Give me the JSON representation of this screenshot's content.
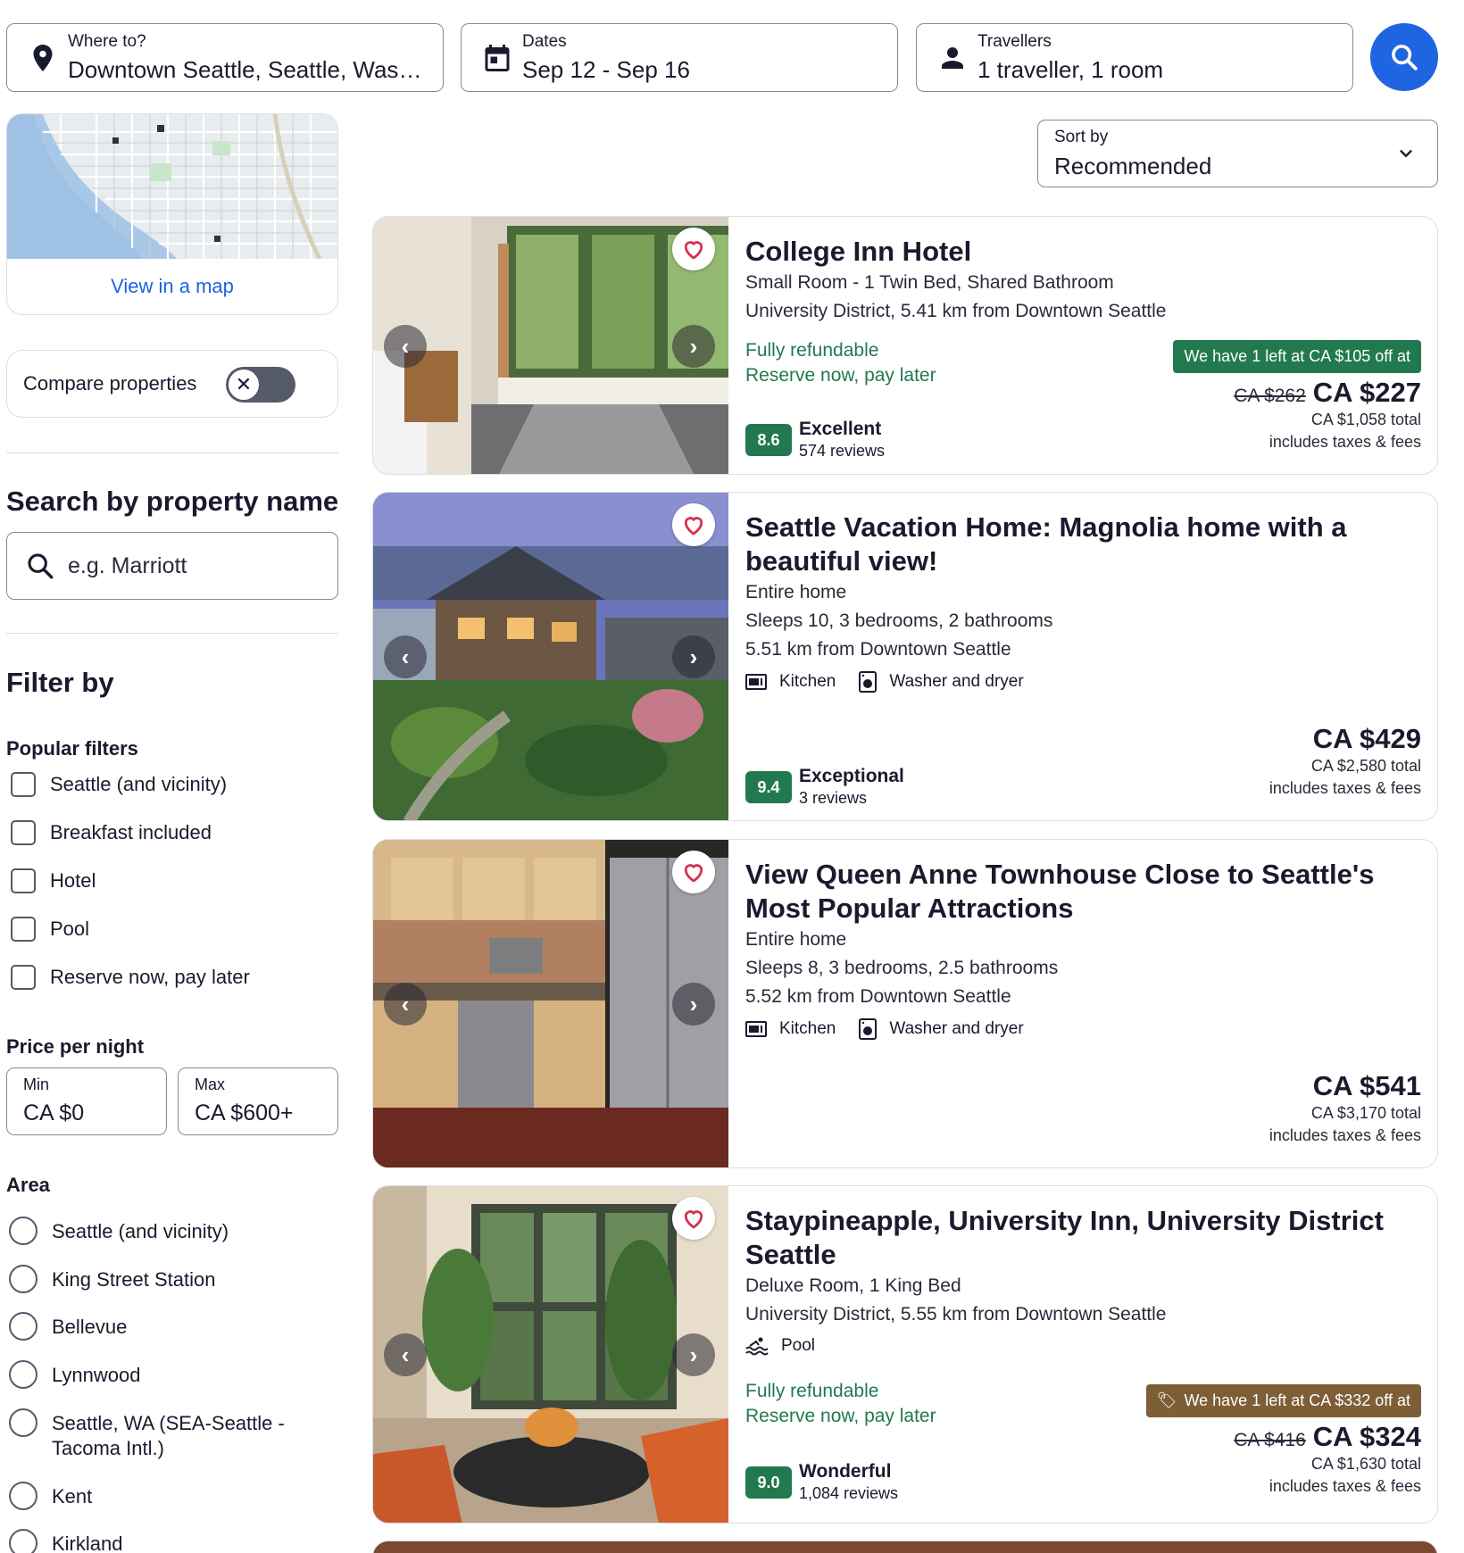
{
  "search": {
    "destination_label": "Where to?",
    "destination_value": "Downtown Seattle, Seattle, Wash...",
    "dates_label": "Dates",
    "dates_value": "Sep 12 - Sep 16",
    "travellers_label": "Travellers",
    "travellers_value": "1 traveller, 1 room"
  },
  "map": {
    "link": "View in a map"
  },
  "compare": {
    "label": "Compare properties",
    "enabled": false
  },
  "property_search": {
    "heading": "Search by property name",
    "placeholder": "e.g. Marriott"
  },
  "filters": {
    "heading": "Filter by",
    "popular_title": "Popular filters",
    "popular": [
      "Seattle (and vicinity)",
      "Breakfast included",
      "Hotel",
      "Pool",
      "Reserve now, pay later"
    ],
    "price_title": "Price per night",
    "price_min_label": "Min",
    "price_min_value": "CA $0",
    "price_max_label": "Max",
    "price_max_value": "CA $600+",
    "area_title": "Area",
    "areas": [
      "Seattle (and vicinity)",
      "King Street Station",
      "Bellevue",
      "Lynnwood",
      "Seattle, WA (SEA-Seattle - Tacoma Intl.)",
      "Kent",
      "Kirkland"
    ]
  },
  "sort": {
    "label": "Sort by",
    "value": "Recommended"
  },
  "listings": [
    {
      "title": "College Inn Hotel",
      "lines": [
        "Small Room - 1 Twin Bed, Shared Bathroom",
        "University District, 5.41 km from Downtown Seattle"
      ],
      "refundable": "Fully refundable",
      "pay_later": "Reserve now, pay later",
      "deal": "We have 1 left at CA $105 off at",
      "old_price": "CA $262",
      "price": "CA $227",
      "total": "CA $1,058 total",
      "fees": "includes taxes & fees",
      "score": "8.6",
      "rating_label": "Excellent",
      "reviews": "574 reviews"
    },
    {
      "title": "Seattle Vacation Home: Magnolia home with a beautiful view!",
      "lines": [
        "Entire home",
        "Sleeps 10, 3 bedrooms, 2 bathrooms",
        "5.51 km from Downtown Seattle"
      ],
      "amenities": [
        "Kitchen",
        "Washer and dryer"
      ],
      "price": "CA $429",
      "total": "CA $2,580 total",
      "fees": "includes taxes & fees",
      "score": "9.4",
      "rating_label": "Exceptional",
      "reviews": "3 reviews"
    },
    {
      "title": "View Queen Anne Townhouse Close to Seattle's Most Popular Attractions",
      "lines": [
        "Entire home",
        "Sleeps 8, 3 bedrooms, 2.5 bathrooms",
        "5.52 km from Downtown Seattle"
      ],
      "amenities": [
        "Kitchen",
        "Washer and dryer"
      ],
      "price": "CA $541",
      "total": "CA $3,170 total",
      "fees": "includes taxes & fees"
    },
    {
      "title": "Staypineapple, University Inn, University District Seattle",
      "lines": [
        "Deluxe Room, 1 King Bed",
        "University District, 5.55 km from Downtown Seattle"
      ],
      "amenities": [
        "Pool"
      ],
      "refundable": "Fully refundable",
      "pay_later": "Reserve now, pay later",
      "deal": "We have 1 left at CA $332 off at",
      "old_price": "CA $416",
      "price": "CA $324",
      "total": "CA $1,630 total",
      "fees": "includes taxes & fees",
      "score": "9.0",
      "rating_label": "Wonderful",
      "reviews": "1,084 reviews"
    }
  ],
  "colors": {
    "accent": "#1f64e0",
    "success": "#227950",
    "deal_gold": "#7d5e37",
    "text": "#1a1a2e"
  }
}
